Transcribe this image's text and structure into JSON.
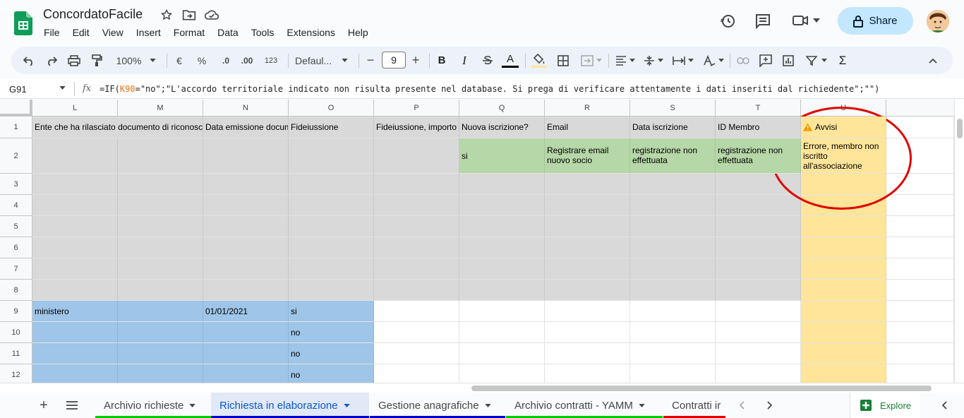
{
  "app": {
    "doc_title": "ConcordatoFacile",
    "share_label": "Share"
  },
  "menu": [
    "File",
    "Edit",
    "View",
    "Insert",
    "Format",
    "Data",
    "Tools",
    "Extensions",
    "Help"
  ],
  "toolbar": {
    "zoom": "100%",
    "currency": "€",
    "percent": "%",
    "dec_less": ".0",
    "dec_more": ".00",
    "number_format": "123",
    "font": "Defaul...",
    "font_size": "9",
    "minus": "−",
    "plus": "+",
    "bold": "B",
    "italic": "I",
    "text_color_letter": "A",
    "sum": "Σ"
  },
  "formula_bar": {
    "cell_ref": "G91",
    "fx": "fx",
    "part1": "=IF(",
    "ref": "K90",
    "part2": "=\"no\";\"L'accordo territoriale indicato non risulta presente nel database. Si prega di verificare attentamente i dati inseriti dal richiedente\";\"\")"
  },
  "columns": [
    "L",
    "M",
    "N",
    "O",
    "P",
    "Q",
    "R",
    "S",
    "T",
    "U"
  ],
  "rows": [
    "1",
    "2",
    "3",
    "4",
    "5",
    "6",
    "7",
    "8",
    "9",
    "10",
    "11",
    "12"
  ],
  "cells": {
    "L1": "Ente che ha rilasciato documento di riconoscimento",
    "N1": "Data emissione documento",
    "O1": "Fideiussione",
    "P1": "Fideiussione, importo",
    "Q1": "Nuova iscrizione?",
    "R1": "Email",
    "S1": "Data iscrizione",
    "T1": "ID Membro",
    "U1": "Avvisi",
    "Q2": "si",
    "R2": "Registrare email nuovo socio",
    "S2": "registrazione non effettuata",
    "T2": "registrazione non effettuata",
    "U2": "Errore, membro non iscritto all'associazione",
    "L9": "ministero",
    "N9": "01/01/2021",
    "O9": "si",
    "O10": "no",
    "O11": "no",
    "O12": "no"
  },
  "colors": {
    "gray_cell": "#d9d9d9",
    "green_cell": "#b6d7a8",
    "yellow_cell": "#ffe599",
    "blue_cell": "#9fc5e8",
    "annotation_circle": "#e00000",
    "share_bg": "#c2e7ff",
    "accent": "#0b57d0"
  },
  "sheet_tabs": [
    {
      "label": "Archivio richieste",
      "color": "#00cc00",
      "active": false
    },
    {
      "label": "Richiesta in elaborazione",
      "color": "#0000cc",
      "active": true
    },
    {
      "label": "Gestione anagrafiche",
      "color": "#0000cc",
      "active": false
    },
    {
      "label": "Archivio contratti - YAMM",
      "color": "#00cc00",
      "active": false
    },
    {
      "label": "Contratti ir",
      "color": "#e00000",
      "active": false
    }
  ],
  "explore_label": "Explore"
}
